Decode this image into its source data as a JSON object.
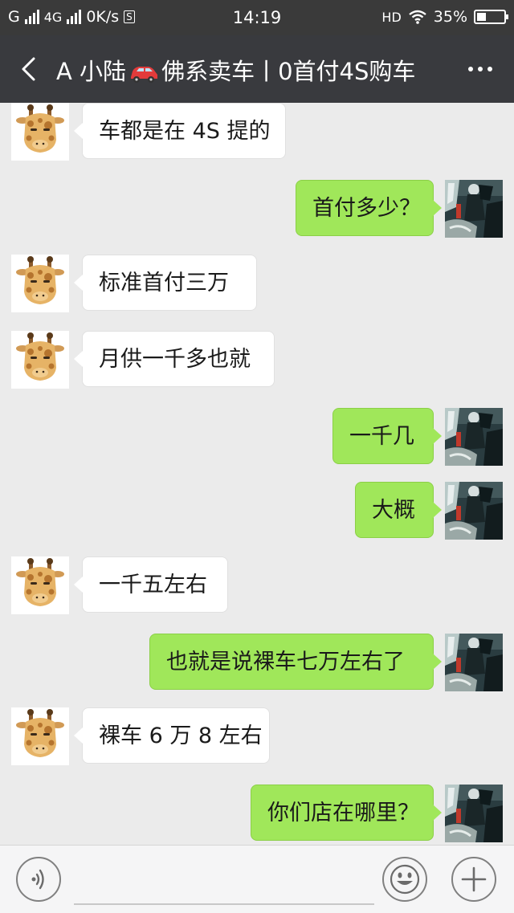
{
  "status_bar": {
    "carrier": "G",
    "network": "4G",
    "speed": "0K/s",
    "speed_box": "S",
    "time": "14:19",
    "hd": "HD",
    "battery": "35%",
    "battery_level": 0.35
  },
  "header": {
    "title_prefix": "A 小陆",
    "title_suffix": "佛系卖车丨0首付4S购车",
    "back_icon": "chevron-left-icon",
    "more_icon": "more-dots-icon"
  },
  "messages": [
    {
      "from": "other",
      "text": "车都是在 4S 提的"
    },
    {
      "from": "me",
      "text": "首付多少？"
    },
    {
      "from": "other",
      "text": "标准首付三万"
    },
    {
      "from": "other",
      "text": "月供一千多也就"
    },
    {
      "from": "me",
      "text": "一千几"
    },
    {
      "from": "me",
      "text": "大概"
    },
    {
      "from": "other",
      "text": "一千五左右"
    },
    {
      "from": "me",
      "text": "也就是说裸车七万左右了"
    },
    {
      "from": "other",
      "text": "裸车 6 万 8 左右"
    },
    {
      "from": "me",
      "text": "你们店在哪里？"
    }
  ],
  "input_bar": {
    "voice_icon": "voice-icon",
    "input_value": "",
    "emoji_icon": "emoji-icon",
    "plus_icon": "plus-icon"
  },
  "colors": {
    "header_bg": "#393a3e",
    "chat_bg": "#ebebeb",
    "out_bubble": "#a0e75a",
    "in_bubble": "#ffffff"
  }
}
